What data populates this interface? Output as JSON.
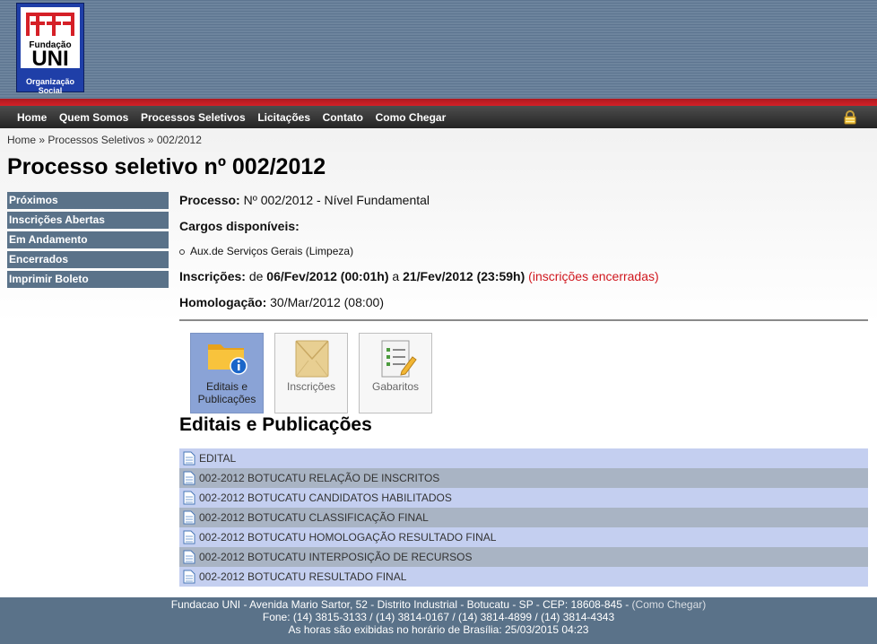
{
  "logo": {
    "top_text": "Fundação",
    "main_text": "UNI",
    "bottom_text": "Organização Social",
    "colors": {
      "background": "#1f3fa8",
      "crosses": "#d52027"
    }
  },
  "nav": {
    "items": [
      "Home",
      "Quem Somos",
      "Processos Seletivos",
      "Licitações",
      "Contato",
      "Como Chegar"
    ],
    "lock_icon": "lock-icon"
  },
  "breadcrumb": {
    "items": [
      "Home",
      "Processos Seletivos",
      "002/2012"
    ],
    "separator": "»"
  },
  "page": {
    "title": "Processo seletivo nº 002/2012"
  },
  "sidebar": {
    "items": [
      "Próximos",
      "Inscrições Abertas",
      "Em Andamento",
      "Encerrados",
      "Imprimir Boleto"
    ]
  },
  "details": {
    "processo_label": "Processo:",
    "processo_value": "Nº 002/2012 - Nível Fundamental",
    "cargos_label": "Cargos disponíveis:",
    "cargos": [
      "Aux.de Serviços Gerais (Limpeza)"
    ],
    "inscricoes_label": "Inscrições:",
    "inscricoes_de": "de",
    "inscricoes_start": "06/Fev/2012 (00:01h)",
    "inscricoes_a": "a",
    "inscricoes_end": "21/Fev/2012 (23:59h)",
    "inscricoes_status": "(inscrições encerradas)",
    "homologacao_label": "Homologação:",
    "homologacao_value": "30/Mar/2012 (08:00)"
  },
  "tabs": [
    {
      "label_line1": "Editais e",
      "label_line2": "Publicações",
      "icon": "folder-info-icon",
      "active": true
    },
    {
      "label_line1": "Inscrições",
      "label_line2": "",
      "icon": "envelope-icon",
      "active": false
    },
    {
      "label_line1": "Gabaritos",
      "label_line2": "",
      "icon": "clipboard-pencil-icon",
      "active": false
    }
  ],
  "section": {
    "title": "Editais e Publicações"
  },
  "documents": [
    "EDITAL",
    "002-2012 BOTUCATU RELAÇÃO DE INSCRITOS",
    "002-2012 BOTUCATU CANDIDATOS HABILITADOS",
    "002-2012 BOTUCATU CLASSIFICAÇÃO FINAL",
    "002-2012 BOTUCATU HOMOLOGAÇÃO RESULTADO FINAL",
    "002-2012 BOTUCATU INTERPOSIÇÃO DE RECURSOS",
    "002-2012 BOTUCATU RESULTADO FINAL"
  ],
  "footer": {
    "line1": "Fundacao UNI - Avenida Mario Sartor, 52 - Distrito Industrial - Botucatu - SP - CEP: 18608-845 -",
    "line1_link": "(Como Chegar)",
    "line2": "Fone: (14) 3815-3133 / (14) 3814-0167 / (14) 3814-4899 / (14) 3814-4343",
    "line3": "As horas são exibidas no horário de Brasília: 25/03/2015 04:23"
  }
}
